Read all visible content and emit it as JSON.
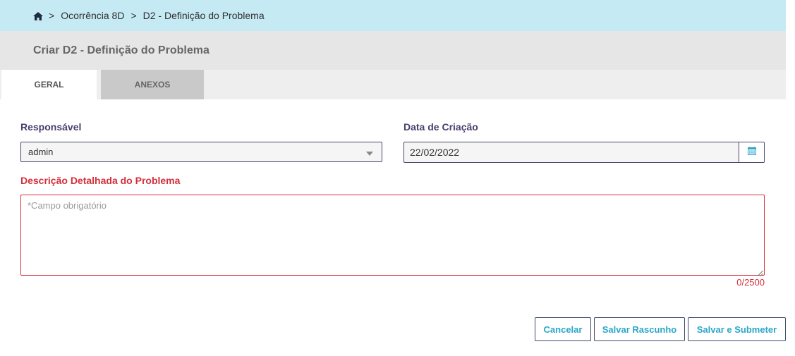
{
  "breadcrumb": {
    "home_icon": "home-icon",
    "separator": ">",
    "items": [
      "Ocorrência 8D",
      "D2 - Definição do Problema"
    ]
  },
  "page": {
    "title": "Criar D2 - Definição do Problema"
  },
  "tabs": [
    {
      "label": "GERAL",
      "active": true
    },
    {
      "label": "ANEXOS",
      "active": false
    }
  ],
  "form": {
    "responsavel": {
      "label": "Responsável",
      "value": "admin"
    },
    "data_criacao": {
      "label": "Data de Criação",
      "value": "22/02/2022",
      "icon": "calendar-icon"
    },
    "descricao": {
      "label": "Descrição Detalhada do Problema",
      "placeholder": "*Campo obrigatório",
      "value": "",
      "counter": "0/2500"
    }
  },
  "actions": {
    "cancel": "Cancelar",
    "save_draft": "Salvar Rascunho",
    "save_submit": "Salvar e Submeter"
  },
  "colors": {
    "breadcrumb_bg": "#c5eaf3",
    "header_bg": "#e6e6e6",
    "label": "#4a3d6e",
    "required": "#d32f3a",
    "button_text": "#2aa7c9"
  }
}
